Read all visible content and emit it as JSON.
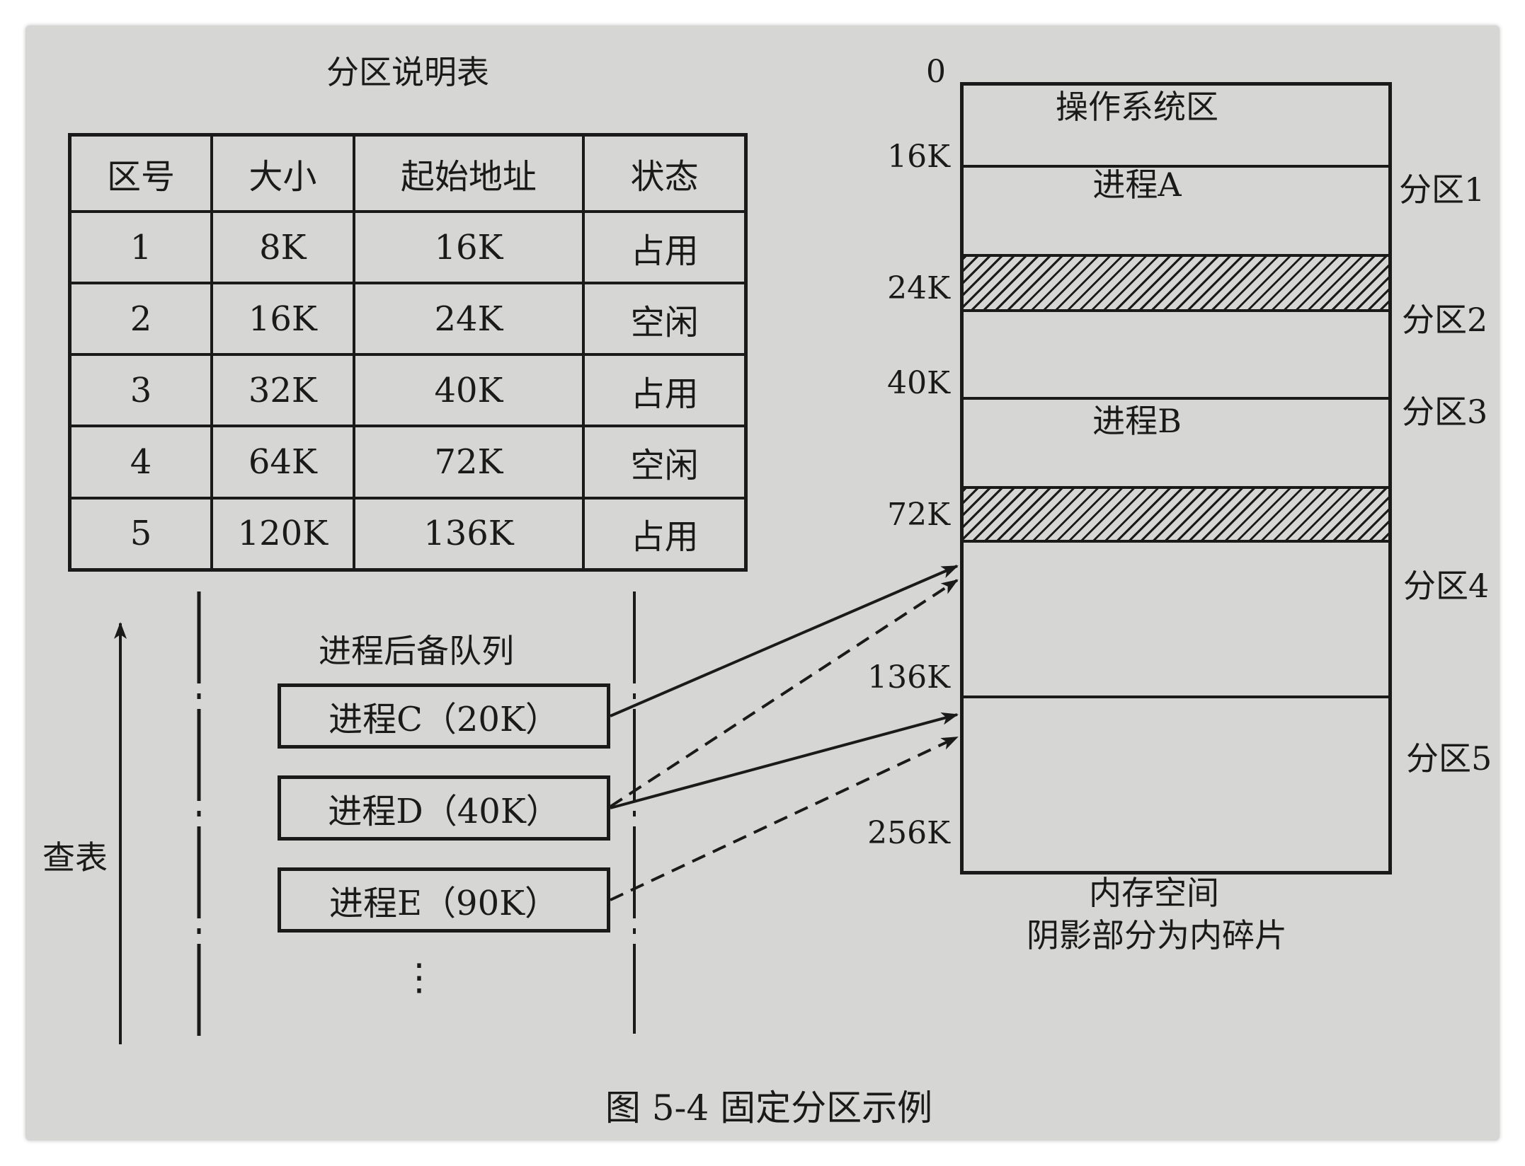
{
  "table": {
    "title": "分区说明表",
    "headers": [
      "区号",
      "大小",
      "起始地址",
      "状态"
    ],
    "rows": [
      [
        "1",
        "8K",
        "16K",
        "占用"
      ],
      [
        "2",
        "16K",
        "24K",
        "空闲"
      ],
      [
        "3",
        "32K",
        "40K",
        "占用"
      ],
      [
        "4",
        "64K",
        "72K",
        "空闲"
      ],
      [
        "5",
        "120K",
        "136K",
        "占用"
      ]
    ]
  },
  "queue": {
    "title": "进程后备队列",
    "processes": [
      "进程C（20K）",
      "进程D（40K）",
      "进程E（90K）"
    ],
    "ellipsis": "⋮",
    "lookup_label": "查表"
  },
  "memory": {
    "os_label": "操作系统区",
    "process_a": "进程A",
    "process_b": "进程B",
    "addresses": [
      "0",
      "16K",
      "24K",
      "40K",
      "72K",
      "136K",
      "256K"
    ],
    "partitions": [
      "分区1",
      "分区2",
      "分区3",
      "分区4",
      "分区5"
    ],
    "caption_line1": "内存空间",
    "caption_line2": "阴影部分为内碎片"
  },
  "figure_caption": "图 5-4   固定分区示例",
  "colors": {
    "paper": "#d6d6d4",
    "ink": "#1a1a1a"
  }
}
